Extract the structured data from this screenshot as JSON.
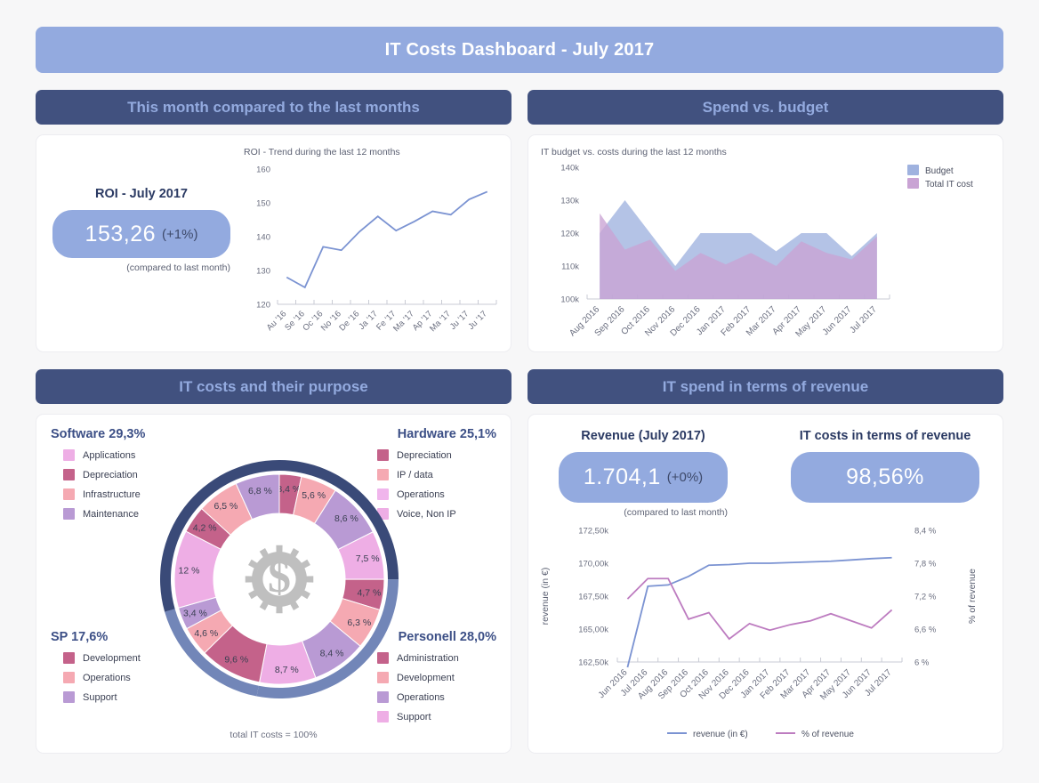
{
  "header": {
    "title": "IT Costs Dashboard - July 2017"
  },
  "sections": {
    "trend": "This month compared to the last months",
    "budget": "Spend vs. budget",
    "purpose": "IT costs and their purpose",
    "revenue": "IT spend in terms of revenue"
  },
  "roi_kpi": {
    "label": "ROI - July 2017",
    "value": "153,26",
    "delta": "(+1%)",
    "note": "(compared to last month)"
  },
  "revenue_kpi": {
    "label": "Revenue (July 2017)",
    "value": "1.704,1",
    "delta": "(+0%)",
    "note": "(compared to last month)"
  },
  "ratio_kpi": {
    "label": "IT costs in terms of revenue",
    "value": "98,56%"
  },
  "donut_footnote": "total IT costs = 100%",
  "colors": {
    "title_bar": "#93aadf",
    "section_head_bg": "#41517f",
    "section_head_text": "#93aadf",
    "kpi_pill": "#93aadf",
    "line_blue": "#7b93d2",
    "line_purple": "#bd7cc0",
    "area_budget": "#9fb2df",
    "area_cost": "#c9a3d4",
    "ring_dark": "#3a4a78",
    "ring_light": "#7286b8",
    "pink_dark": "#c4628a",
    "pink_light": "#f5a9b2",
    "magenta": "#eeaee5",
    "purple": "#b99ad4"
  },
  "donut_groups": [
    {
      "name": "Software",
      "total": "Software 29,3%",
      "legend": [
        {
          "label": "Applications",
          "color": "#eeaee5"
        },
        {
          "label": "Depreciation",
          "color": "#c4628a"
        },
        {
          "label": "Infrastructure",
          "color": "#f5a9b2"
        },
        {
          "label": "Maintenance",
          "color": "#b99ad4"
        }
      ]
    },
    {
      "name": "Hardware",
      "total": "Hardware 25,1%",
      "legend": [
        {
          "label": "Depreciation",
          "color": "#c4628a"
        },
        {
          "label": "IP / data",
          "color": "#f5a9b2"
        },
        {
          "label": "Operations",
          "color": "#f0b5ec"
        },
        {
          "label": "Voice, Non IP",
          "color": "#eeaee5"
        }
      ]
    },
    {
      "name": "SP",
      "total": "SP 17,6%",
      "legend": [
        {
          "label": "Development",
          "color": "#c4628a"
        },
        {
          "label": "Operations",
          "color": "#f5a9b2"
        },
        {
          "label": "Support",
          "color": "#b99ad4"
        }
      ]
    },
    {
      "name": "Personell",
      "total": "Personell 28,0%",
      "legend": [
        {
          "label": "Administration",
          "color": "#c4628a"
        },
        {
          "label": "Development",
          "color": "#f5a9b2"
        },
        {
          "label": "Operations",
          "color": "#b99ad4"
        },
        {
          "label": "Support",
          "color": "#eeaee5"
        }
      ]
    }
  ],
  "chart_data": [
    {
      "type": "line",
      "id": "roi_trend",
      "title": "ROI - Trend during the last 12 months",
      "xlabel": "",
      "ylabel": "",
      "ylim": [
        120,
        160
      ],
      "yticks": [
        120,
        130,
        140,
        150,
        160
      ],
      "grid": false,
      "categories": [
        "Au '16",
        "Se '16",
        "Oc '16",
        "No '16",
        "De '16",
        "Ja '17",
        "Fe '17",
        "Ma '17",
        "Ap '17",
        "Ma '17",
        "Ju '17",
        "Ju '17"
      ],
      "values": [
        128.0,
        125.0,
        137.0,
        136.0,
        141.5,
        146.0,
        141.8,
        144.5,
        147.5,
        146.5,
        151.0,
        153.3
      ],
      "color": "#7b93d2"
    },
    {
      "type": "area",
      "id": "budget_vs_cost",
      "title": "IT budget vs. costs during the last 12 months",
      "xlabel": "",
      "ylabel": "",
      "ylim": [
        100000,
        140000
      ],
      "yticks": [
        "100k",
        "110k",
        "120k",
        "130k",
        "140k"
      ],
      "grid": false,
      "legend_position": "right",
      "categories": [
        "Aug 2016",
        "Sep 2016",
        "Oct 2016",
        "Nov 2016",
        "Dec 2016",
        "Jan 2017",
        "Feb 2017",
        "Mar 2017",
        "Apr 2017",
        "May 2017",
        "Jun 2017",
        "Jul 2017"
      ],
      "series": [
        {
          "name": "Budget",
          "color": "#9fb2df",
          "values": [
            120000,
            130000,
            120000,
            110000,
            120000,
            120000,
            120000,
            114500,
            120000,
            120000,
            113000,
            120000
          ]
        },
        {
          "name": "Total IT cost",
          "color": "#c9a3d4",
          "values": [
            126000,
            115000,
            118000,
            108500,
            114000,
            110500,
            114000,
            110000,
            117500,
            114000,
            112000,
            119000
          ]
        }
      ]
    },
    {
      "type": "pie",
      "id": "it_costs_purpose",
      "title": "IT costs and their purpose",
      "footnote": "total IT costs = 100%",
      "slices": [
        {
          "group": "Hardware",
          "label": "Depreciation",
          "value": 3.4,
          "display": "3,4 %",
          "color": "#c4628a"
        },
        {
          "group": "Hardware",
          "label": "IP / data",
          "value": 5.6,
          "display": "5,6 %",
          "color": "#f5a9b2"
        },
        {
          "group": "Hardware",
          "label": "Operations",
          "value": 8.6,
          "display": "8,6 %",
          "color": "#b99ad4"
        },
        {
          "group": "Hardware",
          "label": "Voice, Non IP",
          "value": 7.5,
          "display": "7,5 %",
          "color": "#eeaee5"
        },
        {
          "group": "Personell",
          "label": "Administration",
          "value": 4.7,
          "display": "4,7 %",
          "color": "#c4628a"
        },
        {
          "group": "Personell",
          "label": "Development",
          "value": 6.3,
          "display": "6,3 %",
          "color": "#f5a9b2"
        },
        {
          "group": "Personell",
          "label": "Operations",
          "value": 8.4,
          "display": "8,4 %",
          "color": "#b99ad4"
        },
        {
          "group": "Personell",
          "label": "Support",
          "value": 8.7,
          "display": "8,7 %",
          "color": "#eeaee5"
        },
        {
          "group": "SP",
          "label": "Development",
          "value": 9.6,
          "display": "9,6 %",
          "color": "#c4628a"
        },
        {
          "group": "SP",
          "label": "Operations",
          "value": 4.6,
          "display": "4,6 %",
          "color": "#f5a9b2"
        },
        {
          "group": "SP",
          "label": "Support",
          "value": 3.4,
          "display": "3,4 %",
          "color": "#b99ad4"
        },
        {
          "group": "Software",
          "label": "Applications",
          "value": 12.0,
          "display": "12 %",
          "color": "#eeaee5"
        },
        {
          "group": "Software",
          "label": "Depreciation",
          "value": 4.2,
          "display": "4,2 %",
          "color": "#c4628a"
        },
        {
          "group": "Software",
          "label": "Infrastructure",
          "value": 6.5,
          "display": "6,5 %",
          "color": "#f5a9b2"
        },
        {
          "group": "Software",
          "label": "Maintenance",
          "value": 6.8,
          "display": "6,8 %",
          "color": "#b99ad4"
        }
      ],
      "outer_ring": [
        {
          "group": "Hardware",
          "value": 25.1,
          "color": "#3a4a78"
        },
        {
          "group": "Personell",
          "value": 28.1,
          "color": "#7286b8"
        },
        {
          "group": "SP",
          "value": 17.6,
          "color": "#7286b8"
        },
        {
          "group": "Software",
          "value": 29.5,
          "color": "#3a4a78"
        }
      ]
    },
    {
      "type": "line",
      "id": "revenue_vs_share",
      "title": "",
      "ylabel": "revenue (in €)",
      "ylabel_right": "% of revenue",
      "ylim": [
        162500,
        172500
      ],
      "yticks": [
        "162,50k",
        "165,00k",
        "167,50k",
        "170,00k",
        "172,50k"
      ],
      "yticks_right": [
        "6 %",
        "6,6 %",
        "7,2 %",
        "7,8 %",
        "8,4 %"
      ],
      "ylim_right": [
        6.0,
        8.4
      ],
      "grid": false,
      "legend_position": "bottom",
      "categories": [
        "Jun 2016",
        "Jul 2016",
        "Aug 2016",
        "Sep 2016",
        "Oct 2016",
        "Nov 2016",
        "Dec 2016",
        "Jan 2017",
        "Feb 2017",
        "Mar 2017",
        "Apr 2017",
        "May 2017",
        "Jun 2017",
        "Jul 2017"
      ],
      "series": [
        {
          "name": "revenue (in €)",
          "color": "#7b93d2",
          "axis": "left",
          "values": [
            161800,
            168250,
            168350,
            169000,
            169850,
            169900,
            170000,
            170000,
            170050,
            170100,
            170150,
            170250,
            170350,
            170420
          ]
        },
        {
          "name": "% of revenue",
          "color": "#bd7cc0",
          "axis": "right",
          "values": [
            7.15,
            7.52,
            7.52,
            6.78,
            6.9,
            6.42,
            6.7,
            6.58,
            6.68,
            6.75,
            6.88,
            6.75,
            6.62,
            6.95
          ]
        }
      ]
    }
  ]
}
